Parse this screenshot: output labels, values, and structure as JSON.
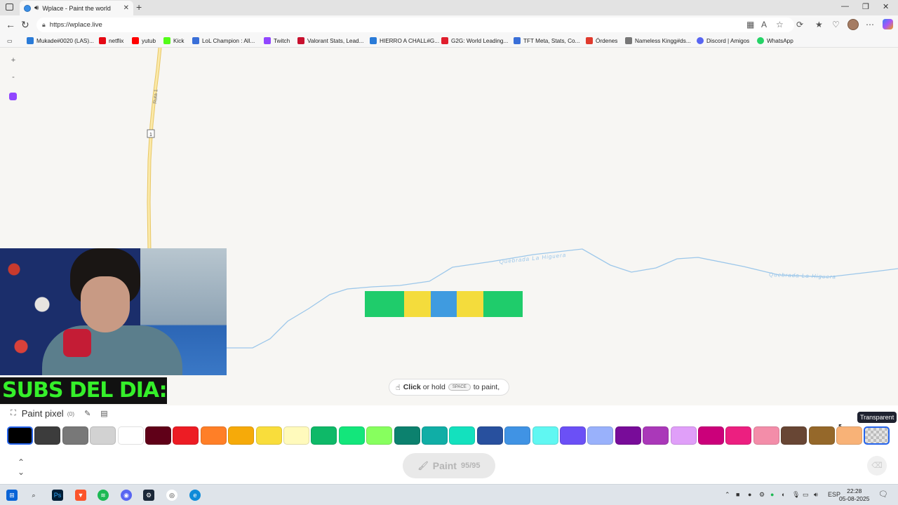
{
  "browser": {
    "tab_title": "Wplace - Paint the world",
    "url": "https://wplace.live",
    "bookmarks": [
      {
        "label": "Mukade#0020 (LAS)...",
        "color": "#2a7bd8"
      },
      {
        "label": "netflix",
        "color": "#e50914"
      },
      {
        "label": "yutub",
        "color": "#ff0000"
      },
      {
        "label": "Kick",
        "color": "#53fc18"
      },
      {
        "label": "LoL Champion : All...",
        "color": "#3a6fd8"
      },
      {
        "label": "Twitch",
        "color": "#9146ff"
      },
      {
        "label": "Valorant Stats, Lead...",
        "color": "#c8102e"
      },
      {
        "label": "HIERRO A CHALL#G...",
        "color": "#2a7bd8"
      },
      {
        "label": "G2G: World Leading...",
        "color": "#e01e2d"
      },
      {
        "label": "TFT Meta, Stats, Co...",
        "color": "#3a6fd8"
      },
      {
        "label": "Órdenes",
        "color": "#e03a2d"
      },
      {
        "label": "Nameless Kingg#ds...",
        "color": "#777777"
      },
      {
        "label": "Discord | Amigos",
        "color": "#5865f2"
      },
      {
        "label": "WhatsApp",
        "color": "#25d366"
      }
    ]
  },
  "map": {
    "road_label": "Ruta 1",
    "road_shield": "1",
    "stream_label_1": "Quebrada La Higuera",
    "stream_label_2": "Quebrada La Higuera",
    "zoom_in": "+",
    "zoom_out": "-",
    "painted_pixels": [
      {
        "color": "#1fcc6b",
        "span": 56
      },
      {
        "color": "#f4dc3c",
        "span": 38
      },
      {
        "color": "#3f9be0",
        "span": 37
      },
      {
        "color": "#f4dc3c",
        "span": 38
      },
      {
        "color": "#1fcc6b",
        "span": 56
      }
    ]
  },
  "overlay": {
    "subs_text": "SUBS DEL DIA:"
  },
  "hint": {
    "click": "Click",
    "or_hold": "or hold",
    "key": "SPACE",
    "to_paint": "to paint,"
  },
  "panel": {
    "title": "Paint pixel",
    "count": "(0)",
    "tooltip": "Transparent",
    "paint_label": "Paint",
    "charges": "95/95",
    "colors": [
      "#000000",
      "#3c3c3c",
      "#787878",
      "#d2d2d2",
      "#ffffff",
      "#600018",
      "#ed1c24",
      "#ff7f27",
      "#f6aa09",
      "#f9dd3b",
      "#fffabc",
      "#0eb968",
      "#13e67b",
      "#87ff5e",
      "#0c816e",
      "#10aea6",
      "#13e1be",
      "#28509e",
      "#4093e4",
      "#60f7f2",
      "#6b50f6",
      "#99b1fb",
      "#780c99",
      "#aa38b9",
      "#e09ff9",
      "#cb007a",
      "#ec1f80",
      "#f38da9",
      "#684634",
      "#95682a",
      "#f8b277",
      "transparent"
    ]
  },
  "taskbar": {
    "language": "ESP",
    "time": "22:28",
    "date": "05-08-2025"
  }
}
